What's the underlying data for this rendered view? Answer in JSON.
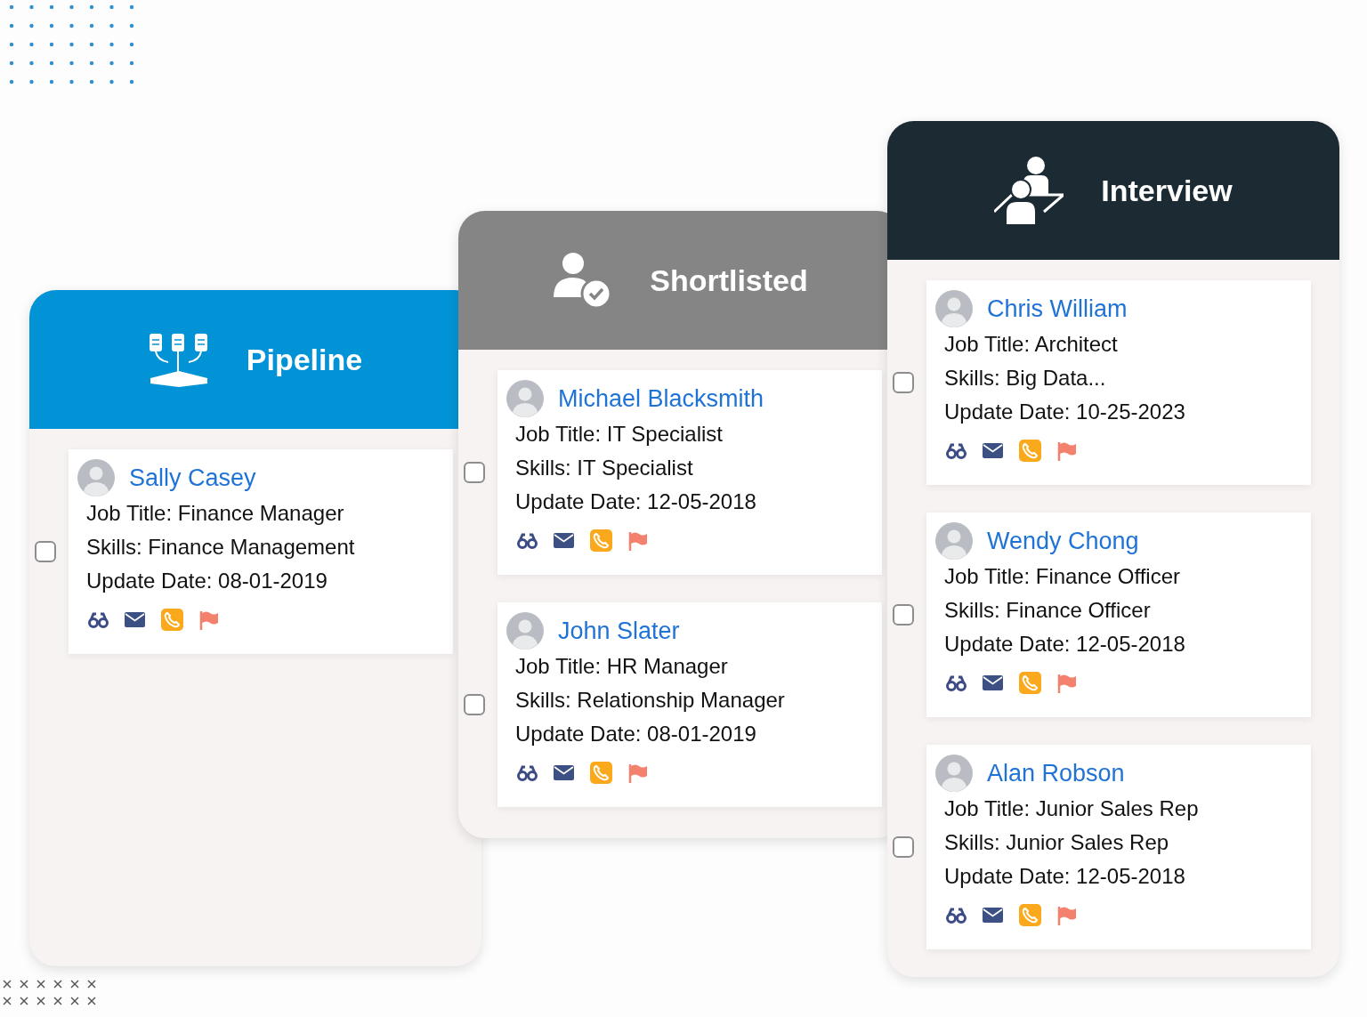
{
  "columns": [
    {
      "title": "Pipeline",
      "kind": "pipeline",
      "color": "#0293d6",
      "candidates": [
        {
          "name": "Sally Casey",
          "job_title": "Job Title: Finance Manager",
          "skills": "Skills: Finance Management",
          "update_date": "Update Date: 08-01-2019",
          "checked": false
        }
      ]
    },
    {
      "title": "Shortlisted",
      "kind": "shortlisted",
      "color": "#858585",
      "candidates": [
        {
          "name": "Michael Blacksmith",
          "job_title": "Job Title: IT Specialist",
          "skills": "Skills: IT Specialist",
          "update_date": "Update Date: 12-05-2018",
          "checked": false
        },
        {
          "name": "John Slater",
          "job_title": "Job Title: HR Manager",
          "skills": "Skills: Relationship Manager",
          "update_date": "Update Date: 08-01-2019",
          "checked": false
        }
      ]
    },
    {
      "title": "Interview",
      "kind": "interview",
      "color": "#1c2a33",
      "candidates": [
        {
          "name": "Chris William",
          "job_title": "Job Title: Architect",
          "skills": "Skills: Big Data...",
          "update_date": "Update Date: 10-25-2023",
          "checked": false
        },
        {
          "name": "Wendy Chong",
          "job_title": "Job Title: Finance Officer",
          "skills": "Skills: Finance Officer",
          "update_date": "Update Date: 12-05-2018",
          "checked": false
        },
        {
          "name": "Alan Robson",
          "job_title": "Job Title: Junior Sales Rep",
          "skills": "Skills: Junior Sales Rep",
          "update_date": "Update Date: 12-05-2018",
          "checked": false
        }
      ]
    }
  ]
}
